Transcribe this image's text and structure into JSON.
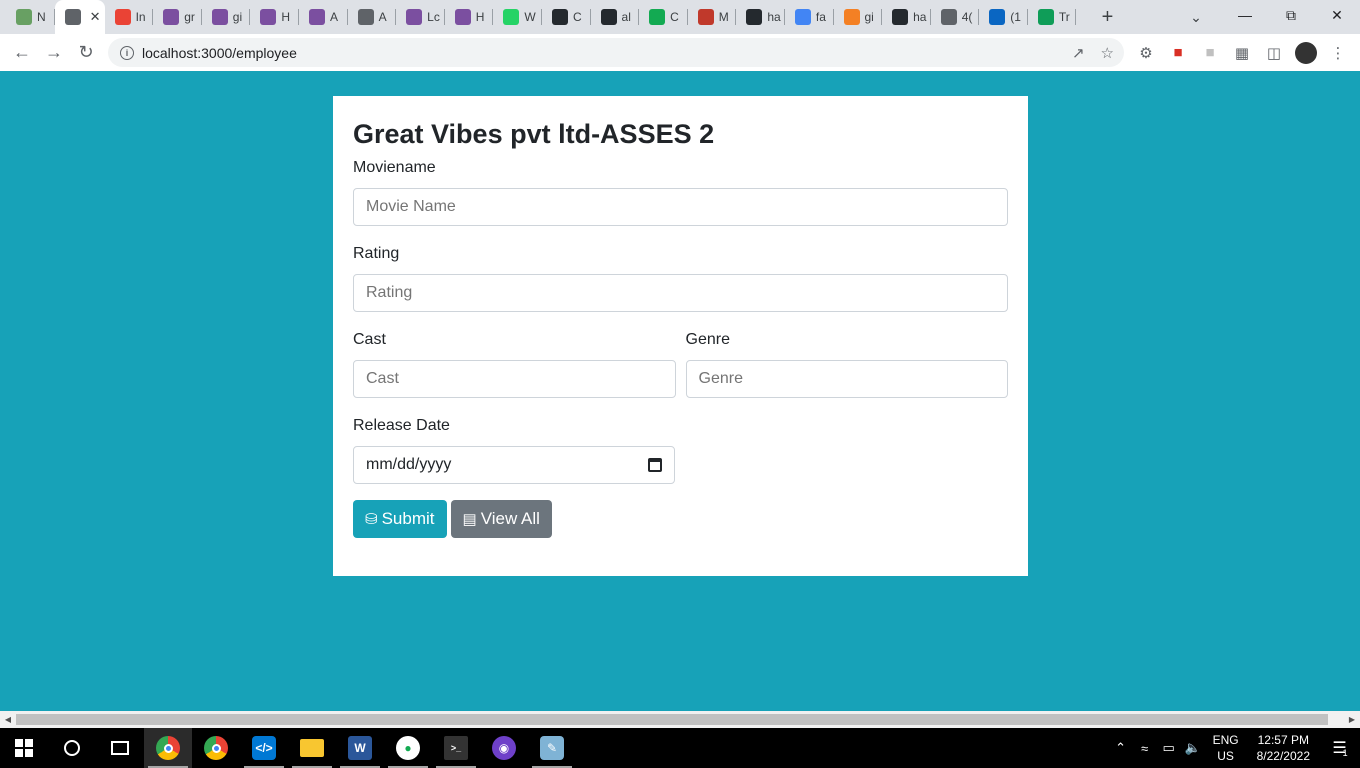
{
  "browser": {
    "tabs": [
      {
        "title": "N",
        "icon": "nodejs-icon",
        "color": "#68a063"
      },
      {
        "title": "",
        "icon": "globe-icon",
        "color": "#5f6368",
        "active": true
      },
      {
        "title": "In",
        "icon": "gmail-icon",
        "color": "#ea4335"
      },
      {
        "title": "gr",
        "icon": "hackerrank-icon",
        "color": "#7b4fa0"
      },
      {
        "title": "gi",
        "icon": "hackerrank-icon",
        "color": "#7b4fa0"
      },
      {
        "title": "H",
        "icon": "hackerrank-icon",
        "color": "#7b4fa0"
      },
      {
        "title": "A",
        "icon": "hackerrank-icon",
        "color": "#7b4fa0"
      },
      {
        "title": "A",
        "icon": "globe-icon",
        "color": "#5f6368"
      },
      {
        "title": "Lc",
        "icon": "hackerrank-icon",
        "color": "#7b4fa0"
      },
      {
        "title": "H",
        "icon": "hackerrank-icon",
        "color": "#7b4fa0"
      },
      {
        "title": "W",
        "icon": "whatsapp-icon",
        "color": "#25d366"
      },
      {
        "title": "C",
        "icon": "github-icon",
        "color": "#24292e"
      },
      {
        "title": "al",
        "icon": "github-icon",
        "color": "#24292e"
      },
      {
        "title": "C",
        "icon": "mongodb-icon",
        "color": "#13aa52"
      },
      {
        "title": "M",
        "icon": "m-icon",
        "color": "#c0392b"
      },
      {
        "title": "ha",
        "icon": "github-icon",
        "color": "#24292e"
      },
      {
        "title": "fa",
        "icon": "google-icon",
        "color": "#4285f4"
      },
      {
        "title": "gi",
        "icon": "stackoverflow-icon",
        "color": "#f48024"
      },
      {
        "title": "ha",
        "icon": "github-icon",
        "color": "#24292e"
      },
      {
        "title": "4(",
        "icon": "globe-icon",
        "color": "#5f6368"
      },
      {
        "title": "(1",
        "icon": "linkedin-icon",
        "color": "#0a66c2"
      },
      {
        "title": "Tr",
        "icon": "w-icon",
        "color": "#0f9d58"
      }
    ],
    "new_tab": "+",
    "url": "localhost:3000/employee"
  },
  "page": {
    "title": "Great Vibes pvt ltd-ASSES 2",
    "fields": {
      "moviename": {
        "label": "Moviename",
        "placeholder": "Movie Name"
      },
      "rating": {
        "label": "Rating",
        "placeholder": "Rating"
      },
      "cast": {
        "label": "Cast",
        "placeholder": "Cast"
      },
      "genre": {
        "label": "Genre",
        "placeholder": "Genre"
      },
      "release_date": {
        "label": "Release Date",
        "value": "mm/dd/yyyy"
      }
    },
    "buttons": {
      "submit": "Submit",
      "view_all": "View All"
    },
    "colors": {
      "background": "#17a2b8",
      "submit": "#17a2b8",
      "view_all": "#6c757d"
    }
  },
  "taskbar": {
    "apps": [
      "chrome-icon",
      "chrome-icon",
      "vscode-icon",
      "file-explorer-icon",
      "word-icon",
      "mongodb-compass-icon",
      "terminal-icon",
      "github-desktop-icon",
      "paint-icon"
    ],
    "lang_line1": "ENG",
    "lang_line2": "US",
    "time": "12:57 PM",
    "date": "8/22/2022",
    "notification_count": "1"
  }
}
